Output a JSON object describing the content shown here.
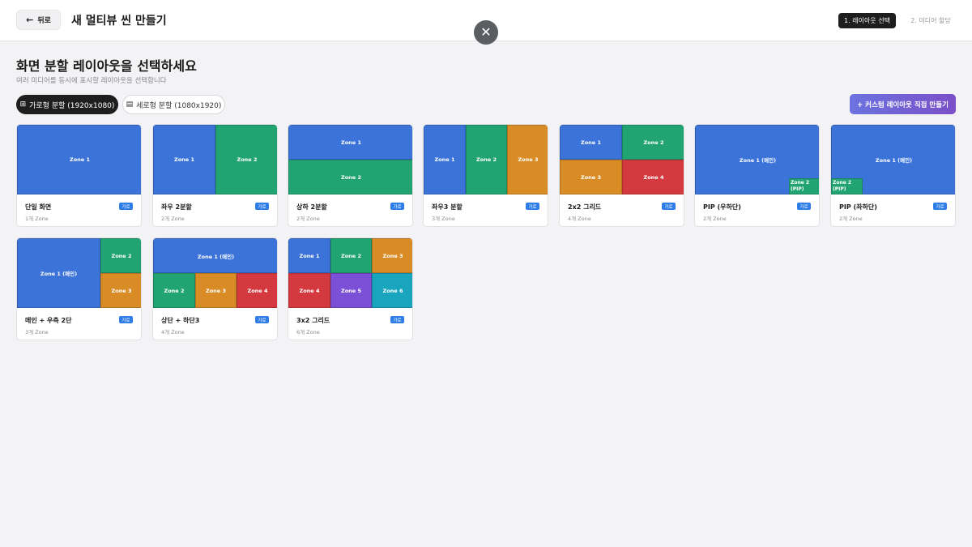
{
  "header": {
    "back_label": "뒤로",
    "title": "새 멀티뷰 씬 만들기",
    "close_symbol": "✕",
    "steps": [
      {
        "label": "1. 레이아웃 선택",
        "active": true
      },
      {
        "label": "2. 미디어 할당",
        "active": false
      }
    ]
  },
  "section": {
    "title": "화면 분할 레이아웃을 선택하세요",
    "subtitle": "여러 미디어를 동시에 표시할 레이아웃을 선택합니다"
  },
  "orientation_tabs": [
    {
      "label": "가로형 분할 (1920x1080)",
      "icon": "grid-icon",
      "active": true
    },
    {
      "label": "세로형 분할 (1080x1920)",
      "icon": "rows-icon",
      "active": false
    }
  ],
  "custom_button": {
    "label": "+ 커스텀 레이아웃 직접 만들기"
  },
  "colors": {
    "blue": "#3b73d9",
    "green": "#21a472",
    "orange": "#d98c25",
    "red": "#d4393f",
    "purple": "#7b4fd6",
    "teal": "#18a5bd",
    "badge": "#2f7ee8",
    "active_tab": "#1e1e1e"
  },
  "layouts": [
    {
      "name": "단일 화면",
      "badge": "가로",
      "count": "1개 Zone",
      "zones": [
        {
          "label": "Zone 1",
          "color": "blue"
        }
      ]
    },
    {
      "name": "좌우 2분할",
      "badge": "가로",
      "count": "2개 Zone",
      "zones": [
        {
          "label": "Zone 1",
          "color": "blue"
        },
        {
          "label": "Zone 2",
          "color": "green"
        }
      ]
    },
    {
      "name": "상하 2분할",
      "badge": "가로",
      "count": "2개 Zone",
      "zones": [
        {
          "label": "Zone 1",
          "color": "blue"
        },
        {
          "label": "Zone 2",
          "color": "green"
        }
      ]
    },
    {
      "name": "좌우3 분할",
      "badge": "가로",
      "count": "3개 Zone",
      "zones": [
        {
          "label": "Zone 1",
          "color": "blue"
        },
        {
          "label": "Zone 2",
          "color": "green"
        },
        {
          "label": "Zone 3",
          "color": "orange"
        }
      ]
    },
    {
      "name": "2x2 그리드",
      "badge": "가로",
      "count": "4개 Zone",
      "zones": [
        {
          "label": "Zone 1",
          "color": "blue"
        },
        {
          "label": "Zone 2",
          "color": "green"
        },
        {
          "label": "Zone 3",
          "color": "orange"
        },
        {
          "label": "Zone 4",
          "color": "red"
        }
      ]
    },
    {
      "name": "PIP (우하단)",
      "badge": "가로",
      "count": "2개 Zone",
      "zones": [
        {
          "label": "Zone 1 (메인)",
          "color": "blue"
        },
        {
          "label": "Zone 2 (PIP)",
          "color": "green"
        }
      ]
    },
    {
      "name": "PIP (좌하단)",
      "badge": "가로",
      "count": "2개 Zone",
      "zones": [
        {
          "label": "Zone 1 (메인)",
          "color": "blue"
        },
        {
          "label": "Zone 2 (PIP)",
          "color": "green"
        }
      ]
    },
    {
      "name": "메인 + 우측 2단",
      "badge": "가로",
      "count": "3개 Zone",
      "zones": [
        {
          "label": "Zone 1 (메인)",
          "color": "blue"
        },
        {
          "label": "Zone 2",
          "color": "green"
        },
        {
          "label": "Zone 3",
          "color": "orange"
        }
      ]
    },
    {
      "name": "상단 + 하단3",
      "badge": "가로",
      "count": "4개 Zone",
      "zones": [
        {
          "label": "Zone 1 (메인)",
          "color": "blue"
        },
        {
          "label": "Zone 2",
          "color": "green"
        },
        {
          "label": "Zone 3",
          "color": "orange"
        },
        {
          "label": "Zone 4",
          "color": "red"
        }
      ]
    },
    {
      "name": "3x2 그리드",
      "badge": "가로",
      "count": "6개 Zone",
      "zones": [
        {
          "label": "Zone 1",
          "color": "blue"
        },
        {
          "label": "Zone 2",
          "color": "green"
        },
        {
          "label": "Zone 3",
          "color": "orange"
        },
        {
          "label": "Zone 4",
          "color": "red"
        },
        {
          "label": "Zone 5",
          "color": "purple"
        },
        {
          "label": "Zone 6",
          "color": "teal"
        }
      ]
    }
  ]
}
